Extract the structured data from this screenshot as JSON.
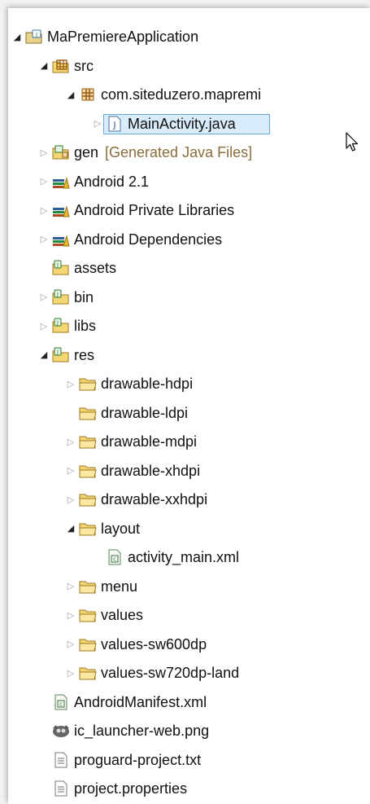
{
  "tree": {
    "items": [
      {
        "label": "MaPremiereApplication",
        "depth": 0,
        "twisty": "expanded",
        "icon": "android-project-icon"
      },
      {
        "label": "src",
        "depth": 1,
        "twisty": "expanded",
        "icon": "source-folder-icon"
      },
      {
        "label": "com.siteduzero.mapremi",
        "depth": 2,
        "twisty": "expanded",
        "icon": "package-icon"
      },
      {
        "label": "MainActivity.java",
        "depth": 3,
        "twisty": "collapsed",
        "icon": "java-file-icon",
        "selected": true
      },
      {
        "label": "gen",
        "decoration": "[Generated Java Files]",
        "depth": 1,
        "twisty": "collapsed",
        "icon": "generated-folder-icon"
      },
      {
        "label": "Android 2.1",
        "depth": 1,
        "twisty": "collapsed",
        "icon": "library-icon"
      },
      {
        "label": "Android Private Libraries",
        "depth": 1,
        "twisty": "collapsed",
        "icon": "library-icon"
      },
      {
        "label": "Android Dependencies",
        "depth": 1,
        "twisty": "collapsed",
        "icon": "library-icon"
      },
      {
        "label": "assets",
        "depth": 1,
        "twisty": "none",
        "icon": "project-folder-icon"
      },
      {
        "label": "bin",
        "depth": 1,
        "twisty": "collapsed",
        "icon": "project-folder-icon"
      },
      {
        "label": "libs",
        "depth": 1,
        "twisty": "collapsed",
        "icon": "project-folder-icon"
      },
      {
        "label": "res",
        "depth": 1,
        "twisty": "expanded",
        "icon": "project-folder-icon"
      },
      {
        "label": "drawable-hdpi",
        "depth": 2,
        "twisty": "collapsed",
        "icon": "folder-icon"
      },
      {
        "label": "drawable-ldpi",
        "depth": 2,
        "twisty": "none",
        "icon": "folder-icon"
      },
      {
        "label": "drawable-mdpi",
        "depth": 2,
        "twisty": "collapsed",
        "icon": "folder-icon"
      },
      {
        "label": "drawable-xhdpi",
        "depth": 2,
        "twisty": "collapsed",
        "icon": "folder-icon"
      },
      {
        "label": "drawable-xxhdpi",
        "depth": 2,
        "twisty": "collapsed",
        "icon": "folder-icon"
      },
      {
        "label": "layout",
        "depth": 2,
        "twisty": "expanded",
        "icon": "folder-icon"
      },
      {
        "label": "activity_main.xml",
        "depth": 3,
        "twisty": "none",
        "icon": "xml-file-icon"
      },
      {
        "label": "menu",
        "depth": 2,
        "twisty": "collapsed",
        "icon": "folder-icon"
      },
      {
        "label": "values",
        "depth": 2,
        "twisty": "collapsed",
        "icon": "folder-icon"
      },
      {
        "label": "values-sw600dp",
        "depth": 2,
        "twisty": "collapsed",
        "icon": "folder-icon"
      },
      {
        "label": "values-sw720dp-land",
        "depth": 2,
        "twisty": "collapsed",
        "icon": "folder-icon"
      },
      {
        "label": "AndroidManifest.xml",
        "depth": 1,
        "twisty": "none",
        "icon": "xml-file-icon"
      },
      {
        "label": "ic_launcher-web.png",
        "depth": 1,
        "twisty": "none",
        "icon": "image-file-icon"
      },
      {
        "label": "proguard-project.txt",
        "depth": 1,
        "twisty": "none",
        "icon": "text-file-icon"
      },
      {
        "label": "project.properties",
        "depth": 1,
        "twisty": "none",
        "icon": "text-file-icon"
      }
    ]
  },
  "colors": {
    "selection_bg": "#d9ecfb",
    "selection_border": "#68aadf",
    "decoration_text": "#8a6d3b"
  }
}
